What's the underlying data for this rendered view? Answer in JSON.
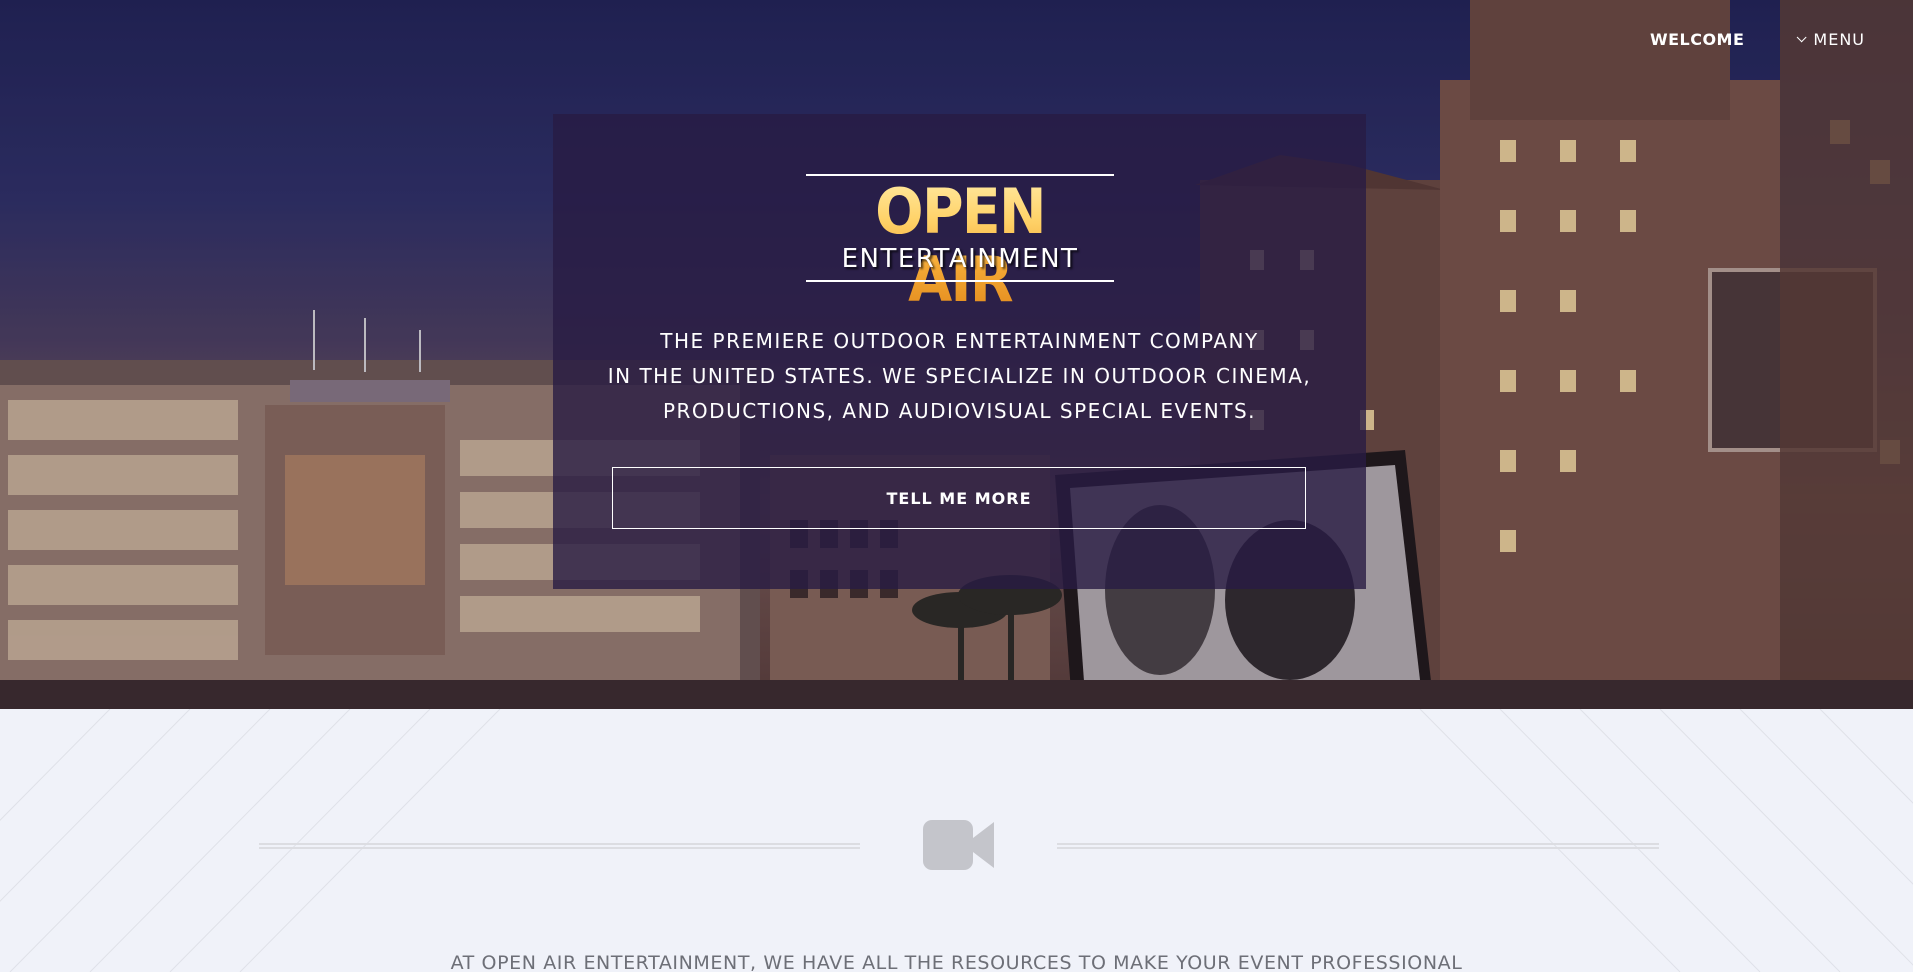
{
  "nav": {
    "welcome": "WELCOME",
    "menu": "MENU",
    "menu_icon": "chevron-down-icon"
  },
  "hero": {
    "logo_main": "OPEN AIR",
    "logo_sub": "ENTERTAINMENT",
    "tagline": [
      "THE PREMIERE OUTDOOR ENTERTAINMENT COMPANY",
      "IN THE UNITED STATES. WE SPECIALIZE IN OUTDOOR CINEMA,",
      "PRODUCTIONS, AND AUDIOVISUAL SPECIAL EVENTS."
    ],
    "cta_label": "TELL ME MORE"
  },
  "section": {
    "icon": "video-camera-icon",
    "intro": "AT OPEN AIR ENTERTAINMENT, WE HAVE ALL THE RESOURCES TO MAKE YOUR EVENT PROFESSIONAL"
  },
  "colors": {
    "card_bg": "#281c44",
    "section_bg": "#f0f2f9",
    "icon_gray": "#c4c5cb",
    "intro_text": "#6d6f77",
    "logo_gold": "#f4a935"
  }
}
